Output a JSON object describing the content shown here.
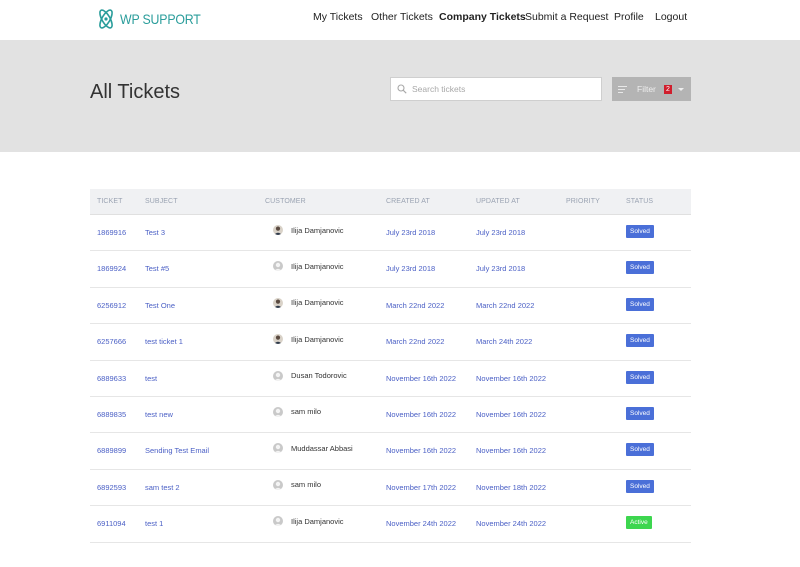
{
  "header": {
    "logo_text": "WP SUPPORT",
    "nav": [
      "My Tickets",
      "Other Tickets",
      "Company Tickets",
      "Submit a Request",
      "Profile",
      "Logout"
    ],
    "active_nav": "Company Tickets"
  },
  "hero": {
    "title": "All Tickets",
    "search_placeholder": "Search tickets",
    "filter_label": "Filter",
    "filter_count": "2"
  },
  "table": {
    "columns": [
      "TICKET",
      "SUBJECT",
      "CUSTOMER",
      "CREATED AT",
      "UPDATED AT",
      "PRIORITY",
      "STATUS"
    ],
    "rows": [
      {
        "ticket": "1869916",
        "subject": "Test 3",
        "customer": "Ilija Damjanovic",
        "avatar": "photo",
        "created": "July 23rd 2018",
        "updated": "July 23rd 2018",
        "priority": "",
        "status": "Solved"
      },
      {
        "ticket": "1869924",
        "subject": "Test #5",
        "customer": "Ilija Damjanovic",
        "avatar": "default",
        "created": "July 23rd 2018",
        "updated": "July 23rd 2018",
        "priority": "",
        "status": "Solved"
      },
      {
        "ticket": "6256912",
        "subject": "Test One",
        "customer": "Ilija Damjanovic",
        "avatar": "photo",
        "created": "March 22nd 2022",
        "updated": "March 22nd 2022",
        "priority": "",
        "status": "Solved"
      },
      {
        "ticket": "6257666",
        "subject": "test ticket 1",
        "customer": "Ilija Damjanovic",
        "avatar": "photo",
        "created": "March 22nd 2022",
        "updated": "March 24th 2022",
        "priority": "",
        "status": "Solved"
      },
      {
        "ticket": "6889633",
        "subject": "test",
        "customer": "Dusan Todorovic",
        "avatar": "default",
        "created": "November 16th 2022",
        "updated": "November 16th 2022",
        "priority": "",
        "status": "Solved"
      },
      {
        "ticket": "6889835",
        "subject": "test new",
        "customer": "sam milo",
        "avatar": "default",
        "created": "November 16th 2022",
        "updated": "November 16th 2022",
        "priority": "",
        "status": "Solved"
      },
      {
        "ticket": "6889899",
        "subject": "Sending Test Email",
        "customer": "Muddassar Abbasi",
        "avatar": "default",
        "created": "November 16th 2022",
        "updated": "November 16th 2022",
        "priority": "",
        "status": "Solved"
      },
      {
        "ticket": "6892593",
        "subject": "sam test 2",
        "customer": "sam milo",
        "avatar": "default",
        "created": "November 17th 2022",
        "updated": "November 18th 2022",
        "priority": "",
        "status": "Solved"
      },
      {
        "ticket": "6911094",
        "subject": "test 1",
        "customer": "Ilija Damjanovic",
        "avatar": "default",
        "created": "November 24th 2022",
        "updated": "November 24th 2022",
        "priority": "",
        "status": "Active"
      }
    ]
  },
  "colors": {
    "brand": "#2a9d9b",
    "link": "#4a5fc5",
    "solved": "#4a6fd8",
    "active": "#3dd64f",
    "hero_bg": "#e2e2e2",
    "filter_bg": "#b4b4b4",
    "badge": "#d01e2c"
  },
  "icons": {
    "logo": "atom-logo-icon",
    "search": "search-icon",
    "filter": "filter-lines-icon",
    "caret": "caret-down-icon"
  }
}
